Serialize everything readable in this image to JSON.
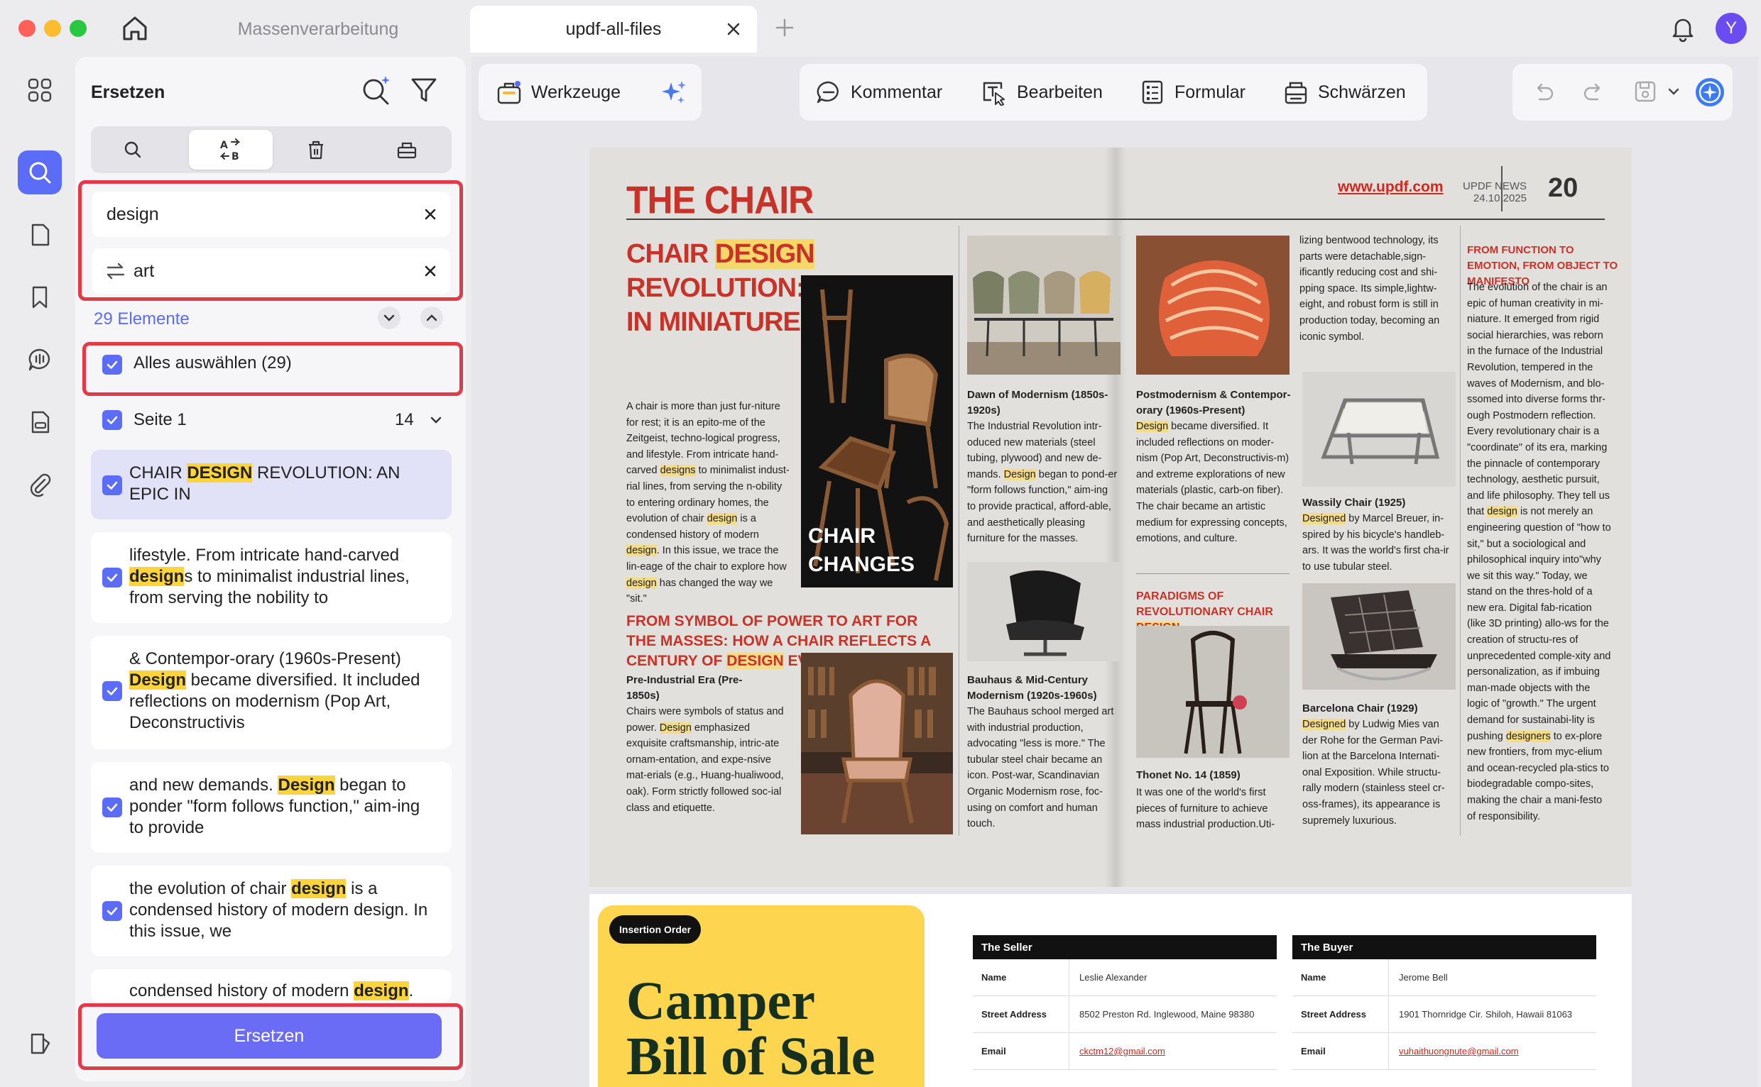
{
  "tabs": [
    {
      "label": "Massenverarbeitung"
    },
    {
      "label": "updf-all-files"
    }
  ],
  "account": {
    "avatar_letter": "Y"
  },
  "panel": {
    "title": "Ersetzen",
    "search_value": "design",
    "replace_value": "art",
    "count_label": "29 Elemente",
    "select_all_label": "Alles auswählen  (29)",
    "page_label": "Seite 1",
    "page_count": "14",
    "results": [
      {
        "pre": "CHAIR ",
        "match": "DESIGN",
        "post": " REVOLUTION: AN EPIC IN"
      },
      {
        "pre": "lifestyle. From intricate hand-carved ",
        "match": "design",
        "post": "s to minimalist industrial lines, from serving the nobility to"
      },
      {
        "pre": "& Contempor-orary (1960s-Present) ",
        "match": "Design",
        "post": " became diversified. It included reflections on modernism (Pop Art, Deconstructivis"
      },
      {
        "pre": "and new demands. ",
        "match": "Design",
        "post": " began to ponder \"form follows function,\" aim-ing to provide"
      },
      {
        "pre": "the evolution of chair ",
        "match": "design",
        "post": " is a condensed history of modern design. In this issue, we"
      },
      {
        "pre": "condensed history of modern ",
        "match": "design",
        "post": "."
      }
    ],
    "replace_button": "Ersetzen"
  },
  "toolbar": {
    "tools_label": "Werkzeuge",
    "comment_label": "Kommentar",
    "edit_label": "Bearbeiten",
    "form_label": "Formular",
    "redact_label": "Schwärzen"
  },
  "document": {
    "title": "THE CHAIR",
    "url": "www.updf.com",
    "news_line1": "UPDF NEWS",
    "news_line2": "24.10.2025",
    "page_number": "20",
    "headline_pre": "CHAIR ",
    "headline_mark": "DESIGN",
    "headline_post": " REVOLUTION: AN EPIC IN MINIATURE",
    "intro_1": "A chair is more than just fur-niture for rest; it is an epito-me of the Zeitgeist, techno-logical progress, and lifestyle. From intricate hand-carved ",
    "intro_m1": "designs",
    "intro_2": " to minimalist indust-rial lines, from serving the n-obility to entering ordinary homes, the evolution of chair ",
    "intro_m2": "design",
    "intro_3": " is a condensed history of modern ",
    "intro_m3": "design",
    "intro_4": ". In this issue, we trace the lin-eage of the chair to explore how ",
    "intro_m4": "design",
    "intro_5": " has changed the way we \"sit.\"",
    "chair_changes_1": "CHAIR",
    "chair_changes_2": "CHANGES",
    "section2_pre": "FROM SYMBOL OF POWER TO ART FOR THE MASSES: HOW A CHAIR REFLECTS A CENTURY OF ",
    "section2_mark": "DESIGN",
    "section2_post": " EVOLUTION",
    "preind_title": "Pre-Industrial Era (Pre-1850s)",
    "preind_1": "Chairs were symbols of status and power. ",
    "preind_m": "Design",
    "preind_2": " emphasized exquisite craftsmanship, intric-ate ornam-entation, and expe-nsive mat-erials (e.g., Huang-hualiwood, oak). Form strictly followed soc-ial class and etiquette.",
    "dawn_title": "Dawn of Modernism (1850s-1920s)",
    "dawn_1": "The Industrial Revolution intr-oduced new materials (steel tubing, plywood) and new de-mands. ",
    "dawn_m": "Design",
    "dawn_2": " began to pond-er \"form follows function,\" aim-ing to provide practical, afford-able, and aesthetically pleasing furniture for the masses.",
    "bauhaus_title": "Bauhaus & Mid-Century Modernism (1920s-1960s)",
    "bauhaus_body": "The Bauhaus school merged art with industrial production, advocating \"less is more.\" The tubular steel chair became an icon. Post-war, Scandinavian Organic Modernism rose, foc-using on comfort and human touch.",
    "postmod_title": "Postmodernism & Contempor-orary (1960s-Present)",
    "postmod_m": "Design",
    "postmod_body": " became diversified. It included reflections on moder-nism (Pop Art, Deconstructivis-m) and extreme explorations of new materials (plastic, carb-on fiber). The chair became an artistic medium for expressing concepts, emotions, and culture.",
    "paradigm_pre": "PARADIGMS OF REVOLUTIONARY CHAIR ",
    "paradigm_mark": "DESIGN",
    "thonet_title": "Thonet No. 14 (1859)",
    "thonet_body": "It was one of the world's first pieces of furniture to achieve mass industrial production.Uti-",
    "col4_top": "lizing bentwood technology, its parts were detachable,sign-ificantly reducing cost and shi-pping space. Its simple,lightw-eight, and robust form is still in production today, becoming an iconic symbol.",
    "wassily_title": "Wassily Chair (1925)",
    "wassily_m": "Designed",
    "wassily_body": " by Marcel Breuer, in-spired by his bicycle's handleb-ars. It was the world's first cha-ir to use tubular steel.",
    "barcelona_title": "Barcelona Chair (1929)",
    "barcelona_m": "Designed",
    "barcelona_body": " by Ludwig Mies van der Rohe for the German Pavi-lion at the Barcelona Internati-onal Exposition. While structu-rally modern (stainless steel cr-oss-frames), its appearance is supremely luxurious.",
    "emotion_title": "FROM FUNCTION TO EMOTION, FROM OBJECT TO MANIFESTO",
    "emotion_1": "The evolution of the chair is an epic of human creativity in mi-niature. It emerged from rigid social hierarchies, was reborn in the furnace of the Industrial Revolution, tempered in the waves of Modernism, and blo-ssomed into diverse forms thr-ough Postmodern reflection. Every revolutionary chair is a \"coordinate\" of its era, marking the pinnacle of contemporary technology, aesthetic pursuit, and life philosophy. They tell us that ",
    "emotion_m1": "design",
    "emotion_2": " is not merely an engineering question of \"how to sit,\" but a sociological and philosophical inquiry into\"why we sit this way.\" Today, we stand on the thres-hold of a new era. Digital fab-rication (like 3D printing) allo-ws for the creation of structu-res of unprecedented comple-xity and personalization, as if imbuing man-made objects with the logic of \"growth.\" The urgent demand for sustainabi-lity is pushing ",
    "emotion_m2": "designers",
    "emotion_3": " to ex-plore new frontiers, from myc-elium and ocean-recycled pla-stics to biodegradable compo-sites, making the chair a mani-festo of responsibility."
  },
  "bill": {
    "badge": "Insertion Order",
    "title_line1": "Camper",
    "title_line2": "Bill of Sale",
    "seller_header": "The Seller",
    "buyer_header": "The Buyer",
    "key_name": "Name",
    "key_address": "Street Address",
    "key_email": "Email",
    "seller_name": "Leslie Alexander",
    "seller_address": "8502 Preston Rd. Inglewood, Maine 98380",
    "seller_email": "ckctm12@gmail.com",
    "buyer_name": "Jerome Bell",
    "buyer_address": "1901 Thornridge Cir. Shiloh, Hawaii 81063",
    "buyer_email": "vuhaithuongnute@gmail.com"
  },
  "colors": {
    "accent": "#5b6cf6",
    "highlight_red": "#e33a48",
    "match_yellow": "#ffd43b",
    "news_red": "#c83228"
  }
}
